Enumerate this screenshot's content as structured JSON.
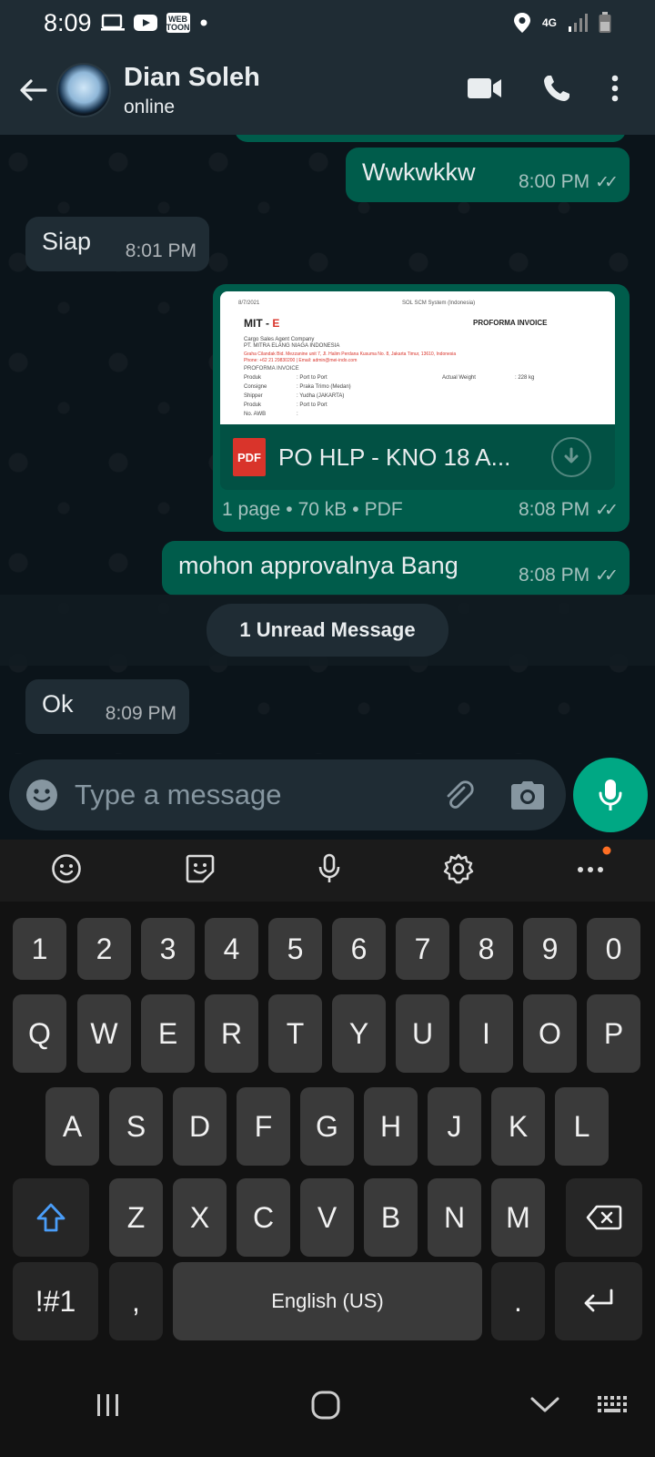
{
  "status_bar": {
    "time": "8:09",
    "webtoon_label": "WEB TOON",
    "network": "4G"
  },
  "header": {
    "contact_name": "Dian Soleh",
    "contact_status": "online"
  },
  "messages": [
    {
      "dir": "out",
      "text": "Wwkwkkw",
      "time": "8:00 PM"
    },
    {
      "dir": "in",
      "text": "Siap",
      "time": "8:01 PM"
    },
    {
      "dir": "out",
      "type": "document",
      "file_name": "PO HLP - KNO 18 A...",
      "pages": "1 page",
      "size": "70 kB",
      "file_type": "PDF",
      "time": "8:08 PM",
      "preview": {
        "date": "8/7/2021",
        "system": "SOL SCM System (Indonesia)",
        "logo_main": "MIT - ",
        "logo_accent": "E",
        "doc_title": "PROFORMA INVOICE",
        "company_line1": "Cargo Sales Agent Company",
        "company_line2": "PT. MITRA ELANG NIAGA INDONESIA",
        "address": "Graha Cilandak Bid. Mezzanine unit 7, Jl. Halim Perdana Kusuma No. 8, Jakarta Timur, 13610, Indonesia",
        "contact": "Phone: +62 21 29830200 | Email: admin@mei-indo.com",
        "section": "PROFORMA INVOICE",
        "rows": [
          {
            "label": "Produk",
            "value": ": Port to Port",
            "extra_label": "Actual Weight",
            "extra_value": ": 228 kg"
          },
          {
            "label": "Consigne",
            "value": ": Praka Trimo (Medan)"
          },
          {
            "label": "Shipper",
            "value": ": Yudha (JAKARTA)"
          },
          {
            "label": "Produk",
            "value": ": Port to Port"
          },
          {
            "label": "No. AWB",
            "value": ":"
          }
        ]
      }
    },
    {
      "dir": "out",
      "text": "mohon approvalnya Bang",
      "time": "8:08 PM"
    },
    {
      "dir": "in",
      "text": "Ok",
      "time": "8:09 PM"
    }
  ],
  "unread_banner": "1 Unread Message",
  "input": {
    "placeholder": "Type a message"
  },
  "keyboard": {
    "numbers": [
      "1",
      "2",
      "3",
      "4",
      "5",
      "6",
      "7",
      "8",
      "9",
      "0"
    ],
    "row1": [
      "Q",
      "W",
      "E",
      "R",
      "T",
      "Y",
      "U",
      "I",
      "O",
      "P"
    ],
    "row2": [
      "A",
      "S",
      "D",
      "F",
      "G",
      "H",
      "J",
      "K",
      "L"
    ],
    "row3": [
      "Z",
      "X",
      "C",
      "V",
      "B",
      "N",
      "M"
    ],
    "symbols_key": "!#1",
    "comma_key": ",",
    "space_label": "English (US)",
    "period_key": "."
  },
  "colors": {
    "outgoing_bubble": "#005c4b",
    "incoming_bubble": "#1f2c34",
    "accent": "#00a884",
    "header_bg": "#1f2c34"
  }
}
